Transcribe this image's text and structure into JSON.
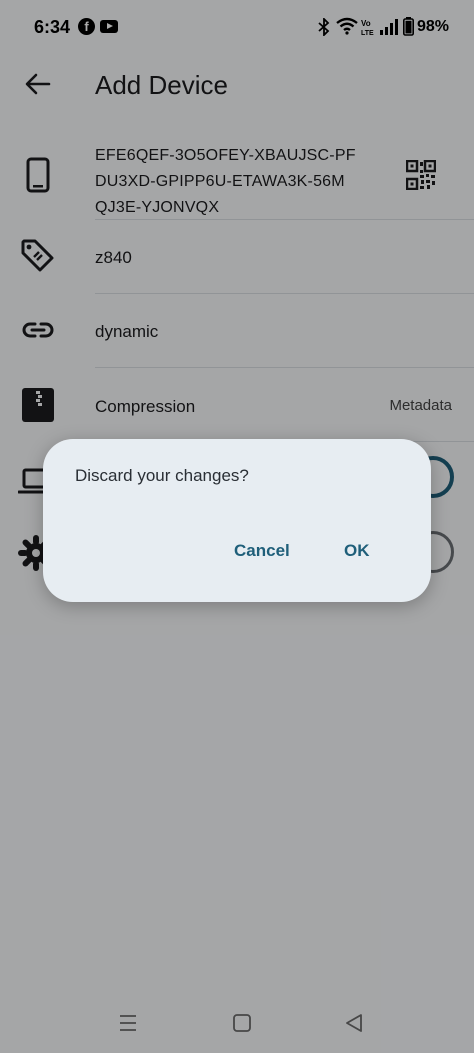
{
  "status_bar": {
    "time": "6:34",
    "battery_percent": "98%",
    "notification_icons": [
      "facebook-icon",
      "youtube-icon"
    ],
    "system_icons": [
      "bluetooth-icon",
      "wifi-icon",
      "volte-icon",
      "signal-icon",
      "battery-icon"
    ]
  },
  "header": {
    "title": "Add Device",
    "back_icon": "arrow-left-icon"
  },
  "rows": {
    "device_id": {
      "icon": "smartphone-icon",
      "lines": [
        "EFE6QEF-3O5OFEY-XBAUJSC-PF",
        "DU3XD-GPIPP6U-ETAWA3K-56M",
        "QJ3E-YJONVQX"
      ],
      "action_icon": "qr-code-icon"
    },
    "device_name": {
      "icon": "tag-icon",
      "value": "z840"
    },
    "addresses": {
      "icon": "link-icon",
      "value": "dynamic"
    },
    "compression": {
      "icon": "zip-file-icon",
      "label": "Compression",
      "value": "Metadata"
    }
  },
  "dialog": {
    "message": "Discard your changes?",
    "cancel_label": "Cancel",
    "ok_label": "OK"
  },
  "nav_bar": {
    "buttons": [
      "recents-icon",
      "home-icon",
      "back-icon"
    ]
  },
  "colors": {
    "accent": "#1f5f7a",
    "dialog_bg": "#e7edf2",
    "scrim": "rgba(0,0,0,0.33)"
  }
}
